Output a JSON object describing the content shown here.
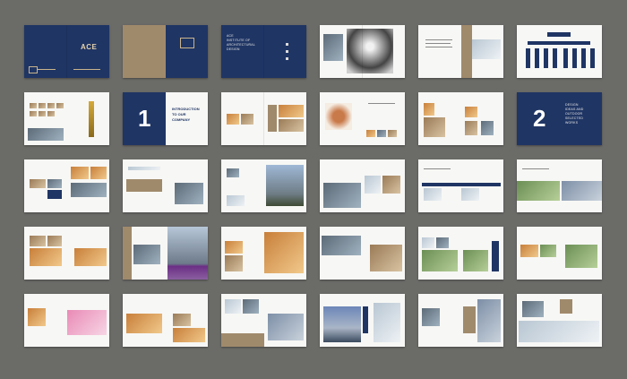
{
  "cover": {
    "logo": "ACE",
    "subtitle_lines": [
      "ACE",
      "INSTITUTE OF",
      "ARCHITECTURAL",
      "DESIGN"
    ]
  },
  "chapter1": {
    "number": "1",
    "title_lines": [
      "INTRODUCTION",
      "TO OUR",
      "COMPANY"
    ]
  },
  "chapter2": {
    "number": "2",
    "title_lines": [
      "DESIGN",
      "IDEAS AND",
      "OUTDOOR",
      "SELECTED",
      "WORKS"
    ]
  }
}
